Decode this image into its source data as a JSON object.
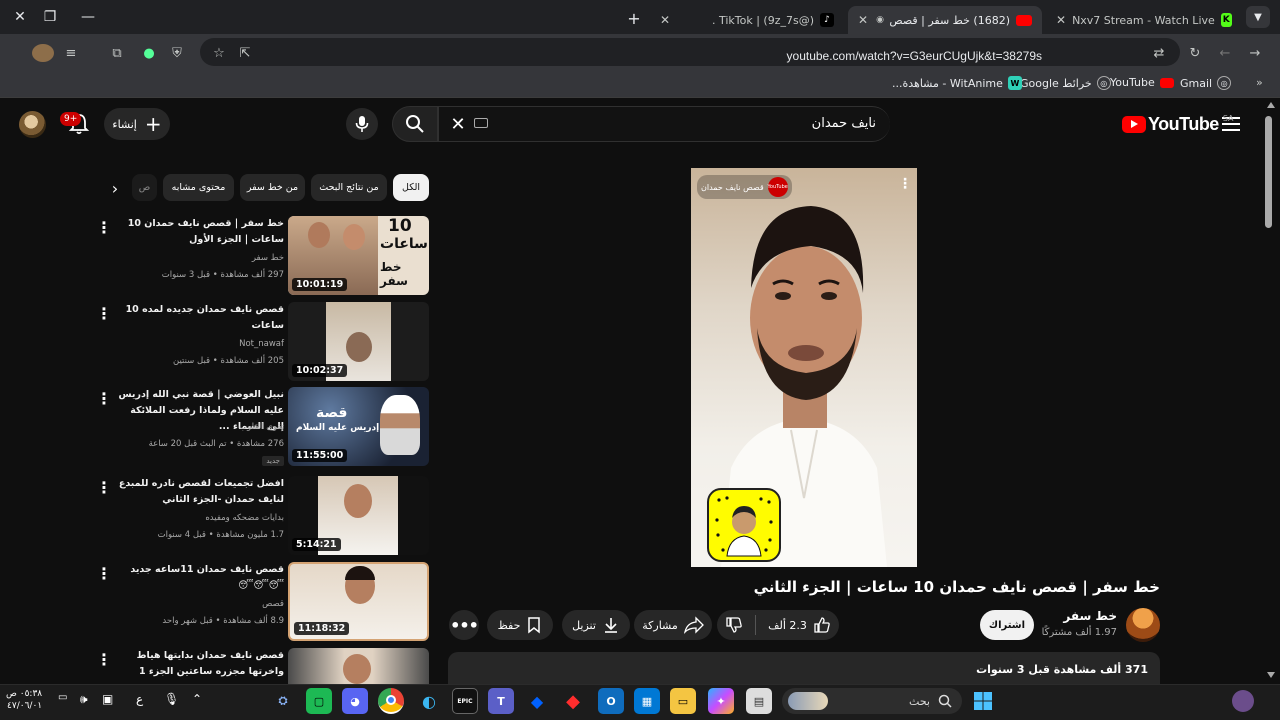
{
  "browser": {
    "tabs": [
      {
        "title": "Nxv7 Stream - Watch Live on Ki",
        "favicon": "kick-icon"
      },
      {
        "title": "(1682) خط سفر | قصص نايف...",
        "favicon": "youtube-icon",
        "active": true
      },
      {
        "title": "TikTok | (9z_7s@) .",
        "favicon": "tiktok-icon"
      }
    ],
    "url": "youtube.com/watch?v=G3eurCUgUjk&t=38279s",
    "bookmarks": [
      {
        "label": "Gmail",
        "icon": "gmail-icon"
      },
      {
        "label": "YouTube",
        "icon": "youtube-icon"
      },
      {
        "label": "خرائط Google",
        "icon": "maps-icon"
      },
      {
        "label": "WitAnime - مشاهدة...",
        "icon": "witanime-icon"
      }
    ]
  },
  "youtube": {
    "logo_text": "YouTube",
    "region": "SA",
    "search_query": "نايف حمدان",
    "create_label": "إنشاء",
    "notification_count": "9+",
    "video": {
      "watermark": "قصص نايف حمدان",
      "title": "خط سفر | قصص نايف حمدان 10 ساعات | الجزء الثاني",
      "channel": "خط سفر",
      "subscribers": "1.97 ألف مشتركًا",
      "subscribe_label": "اشتراك",
      "likes": "2.3 ألف",
      "share_label": "مشاركة",
      "download_label": "تنزيل",
      "save_label": "حفظ",
      "desc_stats": "371 ألف مشاهدة  قبل 3 سنوات"
    },
    "chips": [
      "الكل",
      "من نتائج البحث",
      "من خط سفر",
      "محتوى مشابه",
      "ص"
    ],
    "recommendations": [
      {
        "title": "خط سفر | قصص نايف حمدان 10 ساعات | الجزء الأول",
        "channel": "خط سفر",
        "meta": "297 ألف مشاهدة • قبل 3 سنوات",
        "duration": "10:01:19"
      },
      {
        "title": "قصص نايف حمدان جديده لمده 10 ساعات",
        "channel": "Not_nawaf",
        "meta": "205 ألف مشاهدة • قبل سنتين",
        "duration": "10:02:37"
      },
      {
        "title": "نبيل العوضي | قصة نبي الله إدريس عليه السلام ولماذا رفعت الملائكة إلى السماء ...",
        "channel": "تقوى القلوب",
        "meta": "276 مشاهدة • تم البث قبل 20 ساعة",
        "duration": "11:55:00",
        "badge": "جديد"
      },
      {
        "title": "افضل تجميعات لقصص نادره للمبدع لنايف حمدان -الجزء الثاني",
        "channel": "بدايات مضحكه ومفيده",
        "meta": "1.7 مليون مشاهدة • قبل 4 سنوات",
        "duration": "5:14:21"
      },
      {
        "title": "قصص نايف حمدان 11ساعه جديد 😴😴😴",
        "channel": "قصص",
        "meta": "8.9 ألف مشاهدة • قبل شهر واحد",
        "duration": "11:18:32"
      },
      {
        "title": "قصص نايف حمدان بدايتها هياط واخرتها مجزره ساعتين الجزء 1",
        "channel": "",
        "meta": "",
        "duration": ""
      }
    ]
  },
  "taskbar": {
    "search_placeholder": "بحث",
    "clock_time": "٠٥:٣٨ ص",
    "clock_date": "٤٧/٠٦/٠١",
    "lang": "ع"
  }
}
